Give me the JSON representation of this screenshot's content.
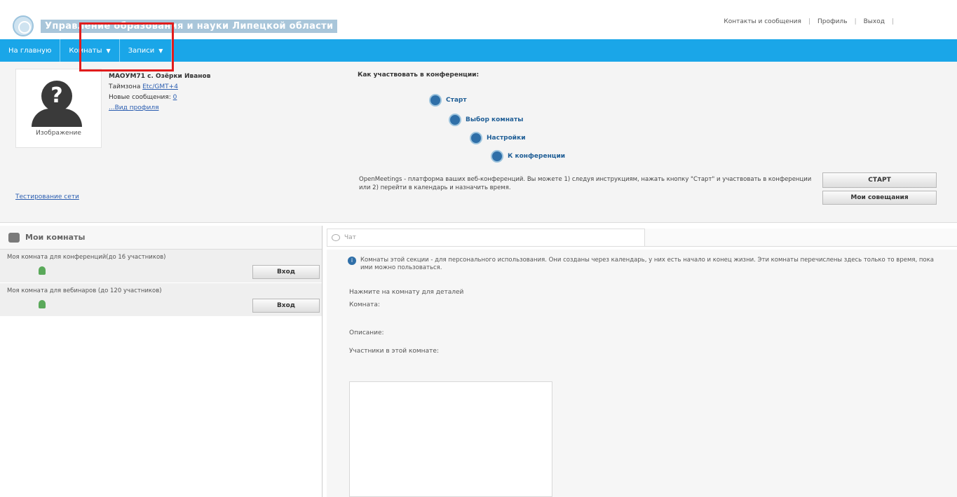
{
  "header": {
    "org_title": "Управление образования и науки Липецкой области",
    "links": [
      "Контакты и сообщения",
      "Профиль",
      "Выход"
    ]
  },
  "nav": {
    "items": [
      {
        "label": "На главную"
      },
      {
        "label": "Комнаты"
      },
      {
        "label": "Записи"
      }
    ]
  },
  "profile": {
    "name": "МАОУМ71 с. Озёрки Иванов",
    "timezone_label": "Таймзона",
    "timezone_value": "Etc/GMT+4",
    "messages_label": "Новые сообщения:",
    "messages_count": "0",
    "view_profile": "...Вид профиля",
    "avatar_caption": "Изображение",
    "network_test": "Тестирование сети"
  },
  "howto": {
    "title": "Как участвовать в конференции:",
    "steps": [
      "Старт",
      "Выбор комнаты",
      "Настройки",
      "К конференции"
    ],
    "description": "OpenMeetings - платформа ваших веб-конференций. Вы можете 1) следуя инструкциям, нажать кнопку \"Старт\" и участвовать в конференции или 2) перейти в календарь и назначить время.",
    "start_button": "СТАРТ",
    "meetings_button": "Мои совещания"
  },
  "rooms": {
    "header": "Мои комнаты",
    "list": [
      {
        "name": "Моя комната для конференций(до 16 участников)",
        "button": "Вход"
      },
      {
        "name": "Моя комната для вебинаров (до 120 участников)",
        "button": "Вход"
      }
    ]
  },
  "detail": {
    "chat_label": "Чат",
    "info_text": "Комнаты этой секции - для персонального использования. Они созданы через календарь, у них есть начало и конец жизни. Эти комнаты перечислены здесь только то время, пока ими можно пользоваться.",
    "click_hint": "Нажмите на комнату для деталей",
    "room_label": "Комната:",
    "description_label": "Описание:",
    "participants_label": "Участники в этой комнате:"
  },
  "colors": {
    "nav_bg": "#1aa6e8",
    "highlight": "#e11c1c"
  }
}
